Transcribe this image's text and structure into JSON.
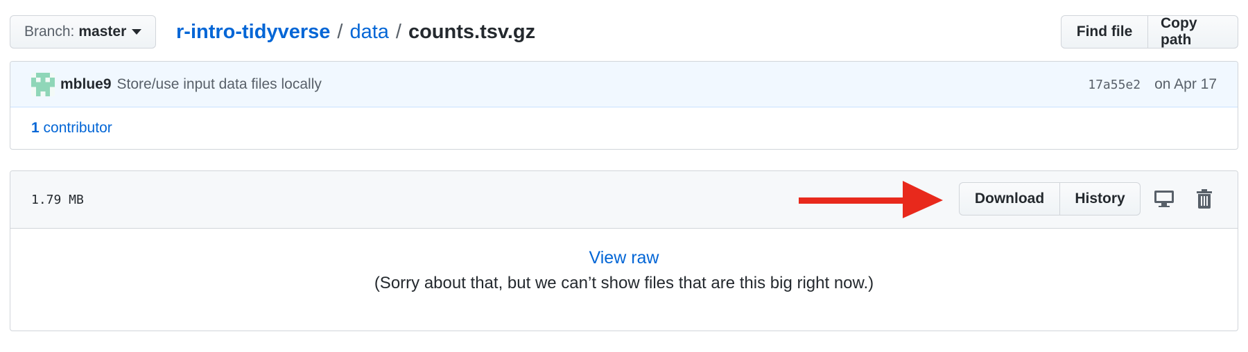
{
  "branch": {
    "label": "Branch:",
    "name": "master"
  },
  "breadcrumb": {
    "repo": "r-intro-tidyverse",
    "separator": "/",
    "folder": "data",
    "file": "counts.tsv.gz"
  },
  "header_actions": {
    "find_file": "Find file",
    "copy_path": "Copy path"
  },
  "commit": {
    "author": "mblue9",
    "message": "Store/use input data files locally",
    "sha": "17a55e2",
    "date": "on Apr 17"
  },
  "contributors": {
    "count": "1",
    "label": "contributor"
  },
  "file": {
    "size": "1.79 MB",
    "download_label": "Download",
    "history_label": "History",
    "view_raw": "View raw",
    "too_big_message": "(Sorry about that, but we can’t show files that are this big right now.)"
  },
  "colors": {
    "link": "#0366d6",
    "arrow": "#e8291c",
    "commit_bg": "#f1f8ff",
    "header_bg": "#f6f8fa",
    "avatar": "#8fd6b8"
  },
  "icons": [
    "caret-down-icon",
    "identicon-avatar",
    "desktop-icon",
    "trash-icon",
    "red-arrow"
  ]
}
